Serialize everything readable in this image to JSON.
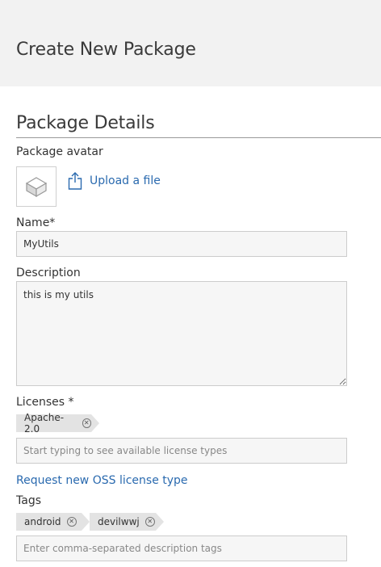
{
  "header": {
    "title": "Create New Package"
  },
  "section": {
    "title": "Package Details"
  },
  "avatar": {
    "label": "Package avatar",
    "upload_label": "Upload a file"
  },
  "name": {
    "label": "Name*",
    "value": "MyUtils"
  },
  "description": {
    "label": "Description",
    "value": "this is my utils"
  },
  "licenses": {
    "label": "Licenses *",
    "items": [
      {
        "label": "Apache-2.0",
        "remove": "⊗"
      }
    ],
    "placeholder": "Start typing to see available license types"
  },
  "request_link": {
    "label": "Request new OSS license type"
  },
  "tags": {
    "label": "Tags",
    "items": [
      {
        "label": "android",
        "remove": "⊗"
      },
      {
        "label": "devilwwj",
        "remove": "⊗"
      }
    ],
    "placeholder": "Enter comma-separated description tags"
  },
  "colors": {
    "link": "#2a6aaf",
    "header_bg": "#f2f2f2",
    "tag_bg": "#e3e3e3"
  }
}
